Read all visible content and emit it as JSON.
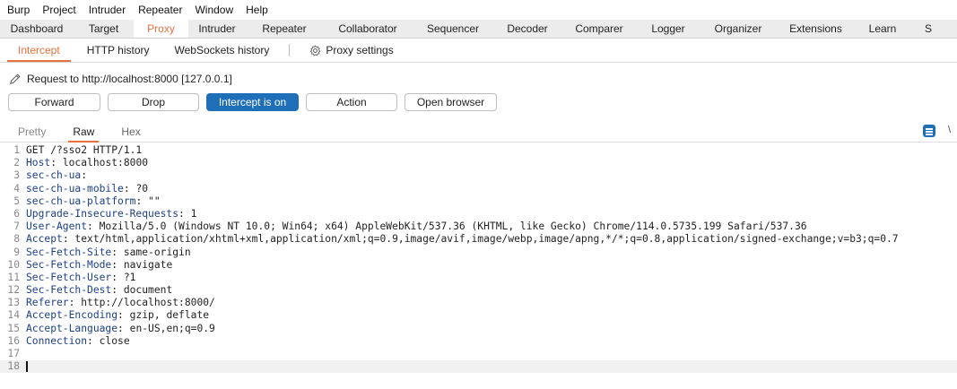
{
  "menubar": [
    "Burp",
    "Project",
    "Intruder",
    "Repeater",
    "Window",
    "Help"
  ],
  "main_tabs": [
    {
      "label": "Dashboard",
      "active": false
    },
    {
      "label": "Target",
      "active": false
    },
    {
      "label": "Proxy",
      "active": true
    },
    {
      "label": "Intruder",
      "active": false
    },
    {
      "label": "Repeater",
      "active": false
    },
    {
      "label": "Collaborator",
      "active": false
    },
    {
      "label": "Sequencer",
      "active": false
    },
    {
      "label": "Decoder",
      "active": false
    },
    {
      "label": "Comparer",
      "active": false
    },
    {
      "label": "Logger",
      "active": false
    },
    {
      "label": "Organizer",
      "active": false
    },
    {
      "label": "Extensions",
      "active": false
    },
    {
      "label": "Learn",
      "active": false
    },
    {
      "label": "S",
      "active": false
    }
  ],
  "proxy_tabs": {
    "intercept": "Intercept",
    "http_history": "HTTP history",
    "websockets_history": "WebSockets history",
    "proxy_settings": "Proxy settings"
  },
  "request_info": "Request to http://localhost:8000  [127.0.0.1]",
  "buttons": {
    "forward": "Forward",
    "drop": "Drop",
    "intercept": "Intercept is on",
    "action": "Action",
    "open_browser": "Open browser"
  },
  "editor_tabs": {
    "pretty": "Pretty",
    "raw": "Raw",
    "hex": "Hex"
  },
  "cut_label": "\\",
  "request_lines": [
    {
      "num": "1",
      "text": "GET /?sso2 HTTP/1.1"
    },
    {
      "num": "2",
      "key": "Host",
      "value": " localhost:8000"
    },
    {
      "num": "3",
      "key": "sec-ch-ua",
      "value": ""
    },
    {
      "num": "4",
      "key": "sec-ch-ua-mobile",
      "value": " ?0"
    },
    {
      "num": "5",
      "key": "sec-ch-ua-platform",
      "value": " \"\""
    },
    {
      "num": "6",
      "key": "Upgrade-Insecure-Requests",
      "value": " 1"
    },
    {
      "num": "7",
      "key": "User-Agent",
      "value": " Mozilla/5.0 (Windows NT 10.0; Win64; x64) AppleWebKit/537.36 (KHTML, like Gecko) Chrome/114.0.5735.199 Safari/537.36"
    },
    {
      "num": "8",
      "key": "Accept",
      "value": " text/html,application/xhtml+xml,application/xml;q=0.9,image/avif,image/webp,image/apng,*/*;q=0.8,application/signed-exchange;v=b3;q=0.7"
    },
    {
      "num": "9",
      "key": "Sec-Fetch-Site",
      "value": " same-origin"
    },
    {
      "num": "10",
      "key": "Sec-Fetch-Mode",
      "value": " navigate"
    },
    {
      "num": "11",
      "key": "Sec-Fetch-User",
      "value": " ?1"
    },
    {
      "num": "12",
      "key": "Sec-Fetch-Dest",
      "value": " document"
    },
    {
      "num": "13",
      "key": "Referer",
      "value": " http://localhost:8000/"
    },
    {
      "num": "14",
      "key": "Accept-Encoding",
      "value": " gzip, deflate"
    },
    {
      "num": "15",
      "key": "Accept-Language",
      "value": " en-US,en;q=0.9"
    },
    {
      "num": "16",
      "key": "Connection",
      "value": " close"
    },
    {
      "num": "17",
      "text": ""
    },
    {
      "num": "18",
      "text": "",
      "current": true
    }
  ],
  "colors": {
    "accent": "#e8703a",
    "primary": "#1f6fb8",
    "header_key": "#1b3f8a"
  }
}
